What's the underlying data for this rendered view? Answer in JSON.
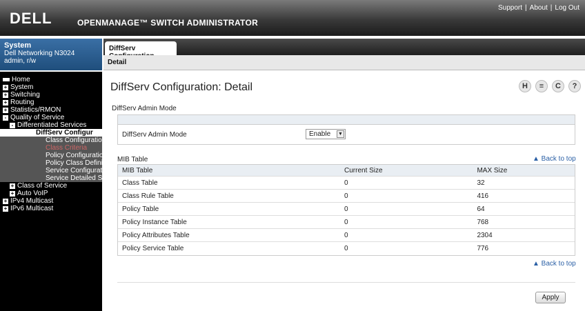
{
  "header": {
    "logo": "DELL",
    "app_title": "OPENMANAGE™ SWITCH ADMINISTRATOR",
    "links": [
      "Support",
      "About",
      "Log Out"
    ]
  },
  "system": {
    "title": "System",
    "device": "Dell Networking N3024",
    "user": "admin, r/w"
  },
  "nav": [
    {
      "label": "Home",
      "icon": "home-icon"
    },
    {
      "label": "System",
      "expander": "+"
    },
    {
      "label": "Switching",
      "expander": "+"
    },
    {
      "label": "Routing",
      "expander": "+"
    },
    {
      "label": "Statistics/RMON",
      "expander": "+"
    },
    {
      "label": "Quality of Service",
      "expander": "-"
    },
    {
      "label": "Differentiated Services",
      "expander": "-"
    },
    {
      "label": "DiffServ Configur"
    },
    {
      "label": "Class Configuration"
    },
    {
      "label": "Class Criteria"
    },
    {
      "label": "Policy Configuration"
    },
    {
      "label": "Policy Class Definit"
    },
    {
      "label": "Service Configuratio"
    },
    {
      "label": "Service Detailed St"
    },
    {
      "label": "Class of Service",
      "expander": "+"
    },
    {
      "label": "Auto VoIP",
      "expander": "+"
    },
    {
      "label": "IPv4 Multicast",
      "expander": "+"
    },
    {
      "label": "IPv6 Multicast",
      "expander": "+"
    }
  ],
  "tabs": {
    "main": "DiffServ Configuration",
    "sub": "Detail"
  },
  "page_title": "DiffServ Configuration: Detail",
  "admin_mode": {
    "section": "DiffServ Admin Mode",
    "label": "DiffServ Admin Mode",
    "value": "Enable"
  },
  "mib": {
    "section": "MIB Table",
    "back_to_top": "▲ Back to top",
    "columns": [
      "MIB Table",
      "Current Size",
      "MAX Size"
    ],
    "rows": [
      [
        "Class Table",
        "0",
        "32"
      ],
      [
        "Class Rule Table",
        "0",
        "416"
      ],
      [
        "Policy Table",
        "0",
        "64"
      ],
      [
        "Policy Instance Table",
        "0",
        "768"
      ],
      [
        "Policy Attributes Table",
        "0",
        "2304"
      ],
      [
        "Policy Service Table",
        "0",
        "776"
      ]
    ]
  },
  "apply_label": "Apply",
  "colors": {
    "accent": "#2a5fa5",
    "nav_bg": "#000000",
    "header_dark": "#1a1a1a"
  }
}
